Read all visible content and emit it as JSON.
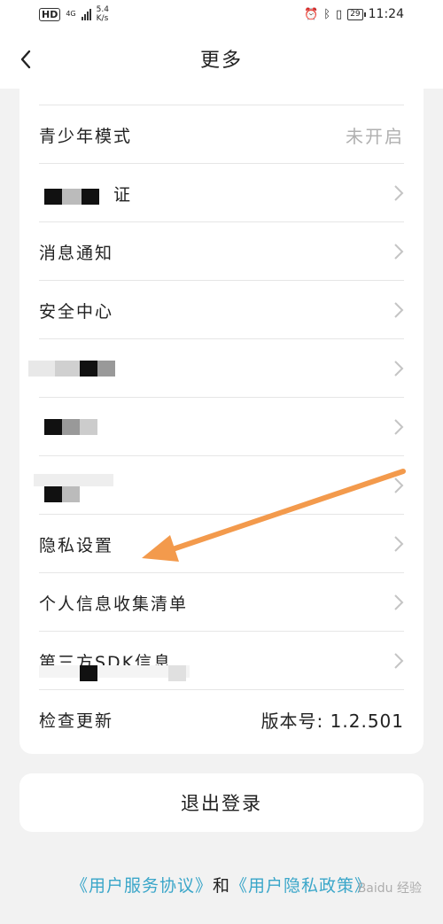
{
  "status_bar": {
    "hd": "HD",
    "network": "4G",
    "speed_value": "5.4",
    "speed_unit": "K/s",
    "battery": "29",
    "time": "11:24"
  },
  "header": {
    "title": "更多"
  },
  "settings": [
    {
      "label": "青少年模式",
      "value": "未开启"
    },
    {
      "label": "证"
    },
    {
      "label": "消息通知"
    },
    {
      "label": "安全中心"
    },
    {
      "label": ""
    },
    {
      "label": ""
    },
    {
      "label": ""
    },
    {
      "label": "隐私设置"
    },
    {
      "label": "个人信息收集清单"
    },
    {
      "label": "第三方SDK信息"
    },
    {
      "label": "检查更新",
      "value": "版本号: 1.2.501"
    }
  ],
  "logout_label": "退出登录",
  "footer": {
    "user_agreement": "《用户服务协议》",
    "and": "和",
    "privacy_policy": "《用户隐私政策》"
  },
  "watermark": "Baidu 经验",
  "colors": {
    "link": "#3aa6c9",
    "annotation_arrow": "#f39a4c"
  }
}
